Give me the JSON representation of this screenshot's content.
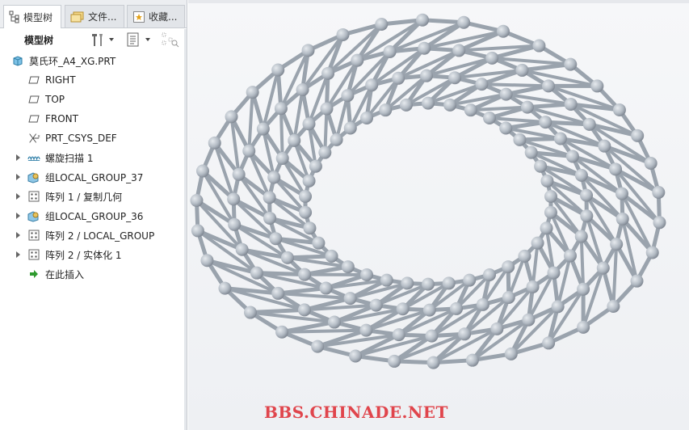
{
  "tabs": [
    {
      "label": "模型树",
      "icon": "model-tree-icon",
      "active": true
    },
    {
      "label": "文件...",
      "icon": "folder-icon",
      "active": false
    },
    {
      "label": "收藏...",
      "icon": "favorites-icon",
      "active": false
    }
  ],
  "toolbar": {
    "title": "模型树",
    "settings_icon": "tree-settings-icon",
    "filter_icon": "tree-columns-icon",
    "extra_icon": "tree-filter-icon"
  },
  "tree": {
    "root": {
      "label": "莫氏环_A4_XG.PRT",
      "icon": "part-icon"
    },
    "items": [
      {
        "label": "RIGHT",
        "icon": "datum-plane-icon",
        "expandable": false
      },
      {
        "label": "TOP",
        "icon": "datum-plane-icon",
        "expandable": false
      },
      {
        "label": "FRONT",
        "icon": "datum-plane-icon",
        "expandable": false
      },
      {
        "label": "PRT_CSYS_DEF",
        "icon": "csys-icon",
        "expandable": false
      },
      {
        "label": "螺旋扫描 1",
        "icon": "helical-sweep-icon",
        "expandable": true
      },
      {
        "label": "组LOCAL_GROUP_37",
        "icon": "group-icon",
        "expandable": true
      },
      {
        "label": "阵列 1 / 复制几何",
        "icon": "pattern-icon",
        "expandable": true
      },
      {
        "label": "组LOCAL_GROUP_36",
        "icon": "group-icon",
        "expandable": true
      },
      {
        "label": "阵列 2 / LOCAL_GROUP",
        "icon": "pattern-icon",
        "expandable": true
      },
      {
        "label": "阵列 2 / 实体化 1",
        "icon": "pattern-icon",
        "expandable": true
      },
      {
        "label": "在此插入",
        "icon": "insert-here-icon",
        "expandable": false
      }
    ]
  },
  "viewport": {
    "model": "torus-lattice",
    "watermark": "BBS.CHINADE.NET",
    "colors": {
      "strut": "#9aa3ad",
      "node": "#b3bbc4",
      "watermark": "#e0454c"
    }
  }
}
